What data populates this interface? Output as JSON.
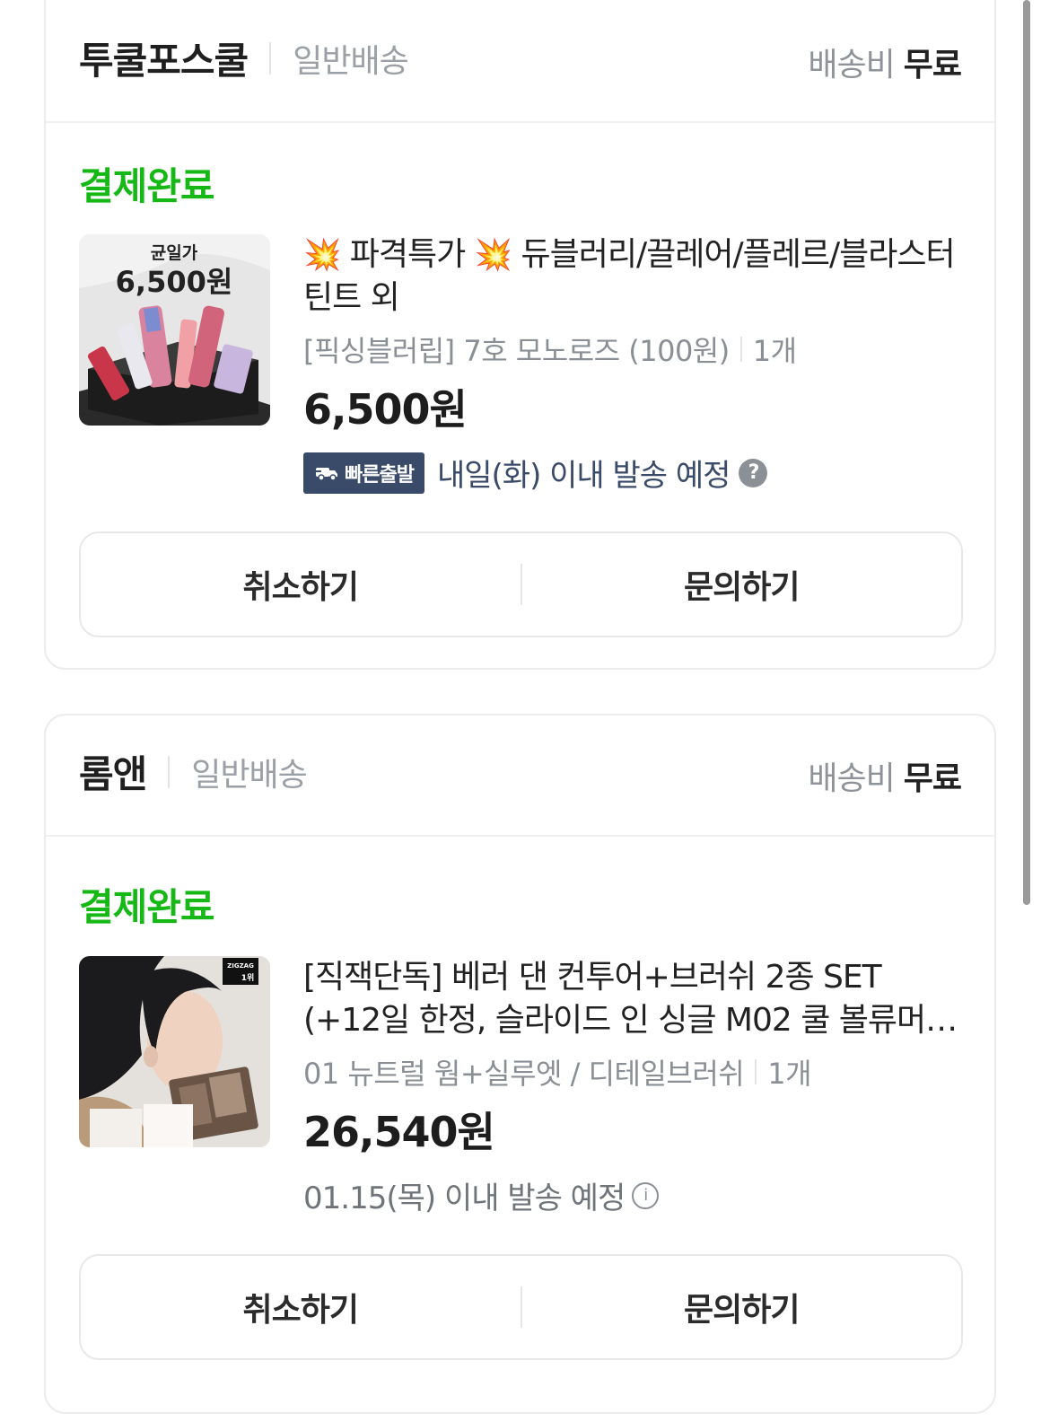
{
  "orders": [
    {
      "store": "투쿨포스쿨",
      "ship_type": "일반배송",
      "ship_fee_label": "배송비",
      "ship_fee_value": "무료",
      "status": "결제완료",
      "thumb_price_label": "균일가",
      "thumb_price": "6,500원",
      "title_prefix_emoji": "💥",
      "title_part1": "파격특가",
      "title_part2": "듀블러리/끌레어/플레르/블라스터 틴트 외",
      "option": "[픽싱블러립] 7호 모노로즈 (100원)",
      "qty": "1개",
      "price": "6,500원",
      "fast_badge": "빠른출발",
      "delivery": "내일(화) 이내 발송 예정",
      "cancel": "취소하기",
      "inquiry": "문의하기"
    },
    {
      "store": "롬앤",
      "ship_type": "일반배송",
      "ship_fee_label": "배송비",
      "ship_fee_value": "무료",
      "status": "결제완료",
      "thumb_badge": "ZIGZAG",
      "title": "[직잭단독] 베러 댄 컨투어+브러쉬 2종 SET (+12일 한정, 슬라이드 인 싱글 M02 쿨 볼류머 0...",
      "option": "01 뉴트럴 웜+실루엣 / 디테일브러쉬",
      "qty": "1개",
      "price": "26,540원",
      "delivery": "01.15(목) 이내 발송 예정",
      "cancel": "취소하기",
      "inquiry": "문의하기"
    }
  ],
  "colors": {
    "status_green": "#15b815",
    "fast_badge_bg": "#3a4b69"
  }
}
